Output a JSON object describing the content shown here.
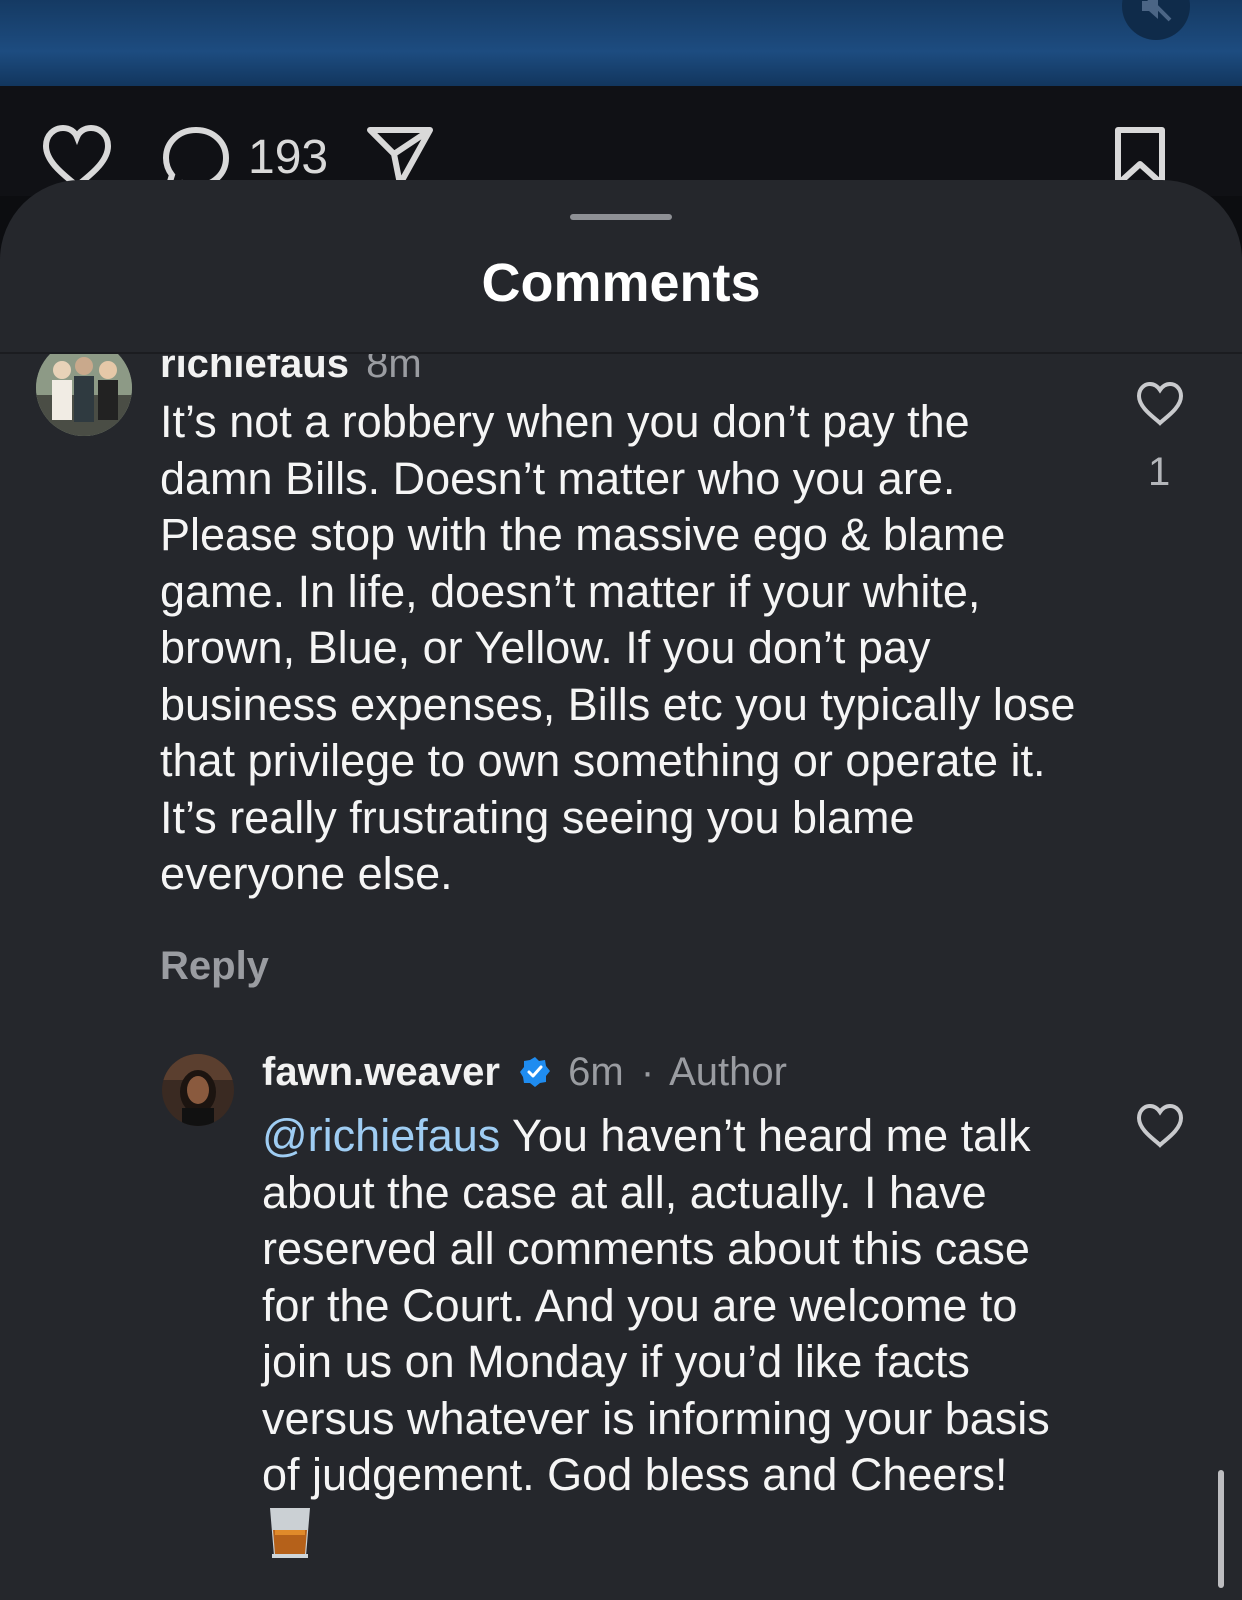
{
  "post_actions": {
    "comment_count": "193"
  },
  "sheet": {
    "title": "Comments"
  },
  "comments": [
    {
      "username": "richiefaus",
      "time": "8m",
      "text": "It’s not a robbery when you don’t pay the damn Bills. Doesn’t matter who you are. Please stop with the massive ego & blame game. In life, doesn’t matter if your white, brown, Blue, or Yellow.  If you don’t pay business expenses, Bills etc you typically lose that privilege to own something or operate it. It’s really frustrating seeing you blame everyone else.",
      "like_count": "1",
      "reply_label": "Reply"
    },
    {
      "username": "fawn.weaver",
      "verified": true,
      "time": "6m",
      "separator": "·",
      "badge": "Author",
      "mention": "@richiefaus",
      "text": " You haven’t heard me talk about the case at all, actually. I have reserved all comments about this case for the Court. And you are welcome to join us on Monday if you’d like facts versus whatever is informing your basis of judgement. God bless and Cheers! ",
      "emoji_icon": "whiskey-glass-icon"
    }
  ],
  "colors": {
    "sheet_bg": "#25272c",
    "mention": "#9fcdf3",
    "verified": "#1f8cf0"
  }
}
